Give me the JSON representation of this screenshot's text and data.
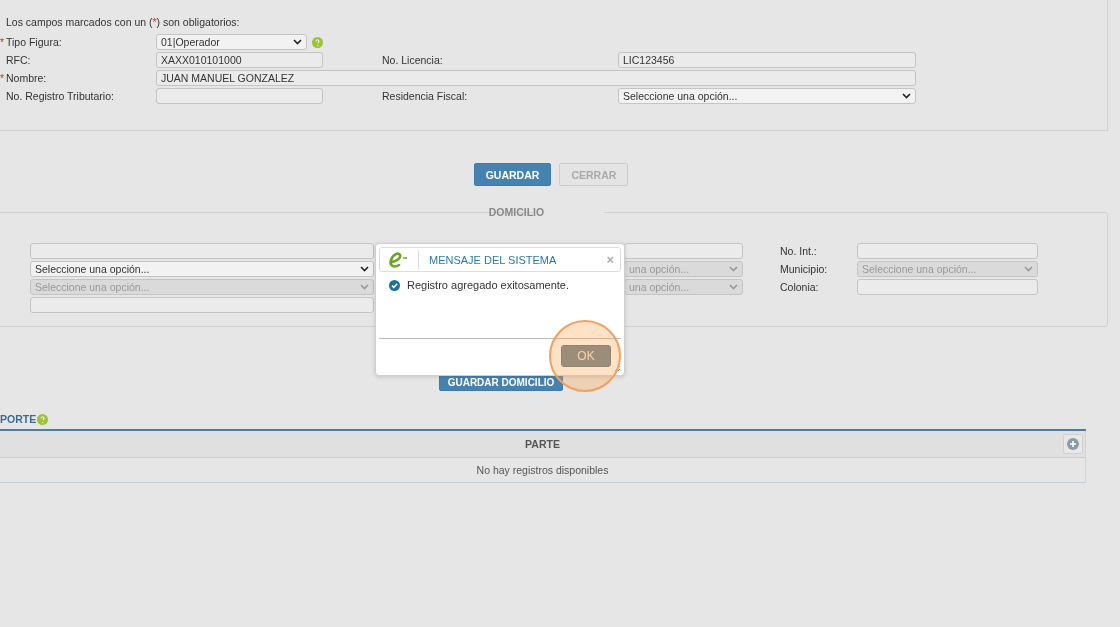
{
  "form": {
    "note": [
      "Los campos marcados con un (",
      "*",
      ") son obligatorios:"
    ],
    "rows": [
      {
        "fields": [
          {
            "label": "Tipo Figura:",
            "required": true,
            "kind": "select",
            "value": "01|Operador",
            "help": true
          }
        ]
      },
      {
        "fields": [
          {
            "label": "RFC:",
            "required": false,
            "kind": "input",
            "value": "XAXX010101000"
          },
          {
            "label": "No. Licencia:",
            "required": false,
            "kind": "input",
            "value": "LIC123456"
          }
        ]
      },
      {
        "fields": [
          {
            "label": "Nombre:",
            "required": true,
            "kind": "input",
            "value": "JUAN MANUEL GONZALEZ",
            "wide": true
          }
        ]
      },
      {
        "fields": [
          {
            "label": "No. Registro Tributario:",
            "required": false,
            "kind": "input"
          },
          {
            "label": "Residencia Fiscal:",
            "required": false,
            "kind": "select",
            "value": "Seleccione una opción..."
          }
        ]
      }
    ]
  },
  "buttons": [
    {
      "label": "GUARDAR",
      "disabled": false
    },
    {
      "label": "CERRAR",
      "disabled": true
    }
  ],
  "domicilio": {
    "legend": "DOMICILIO",
    "rows": [
      {
        "cells": [
          {
            "kind": "input",
            "disabled": false
          },
          {
            "kind": "input",
            "disabled": false
          },
          {
            "kind": "label",
            "text": "No. Int.:"
          },
          {
            "kind": "input",
            "disabled": false
          }
        ]
      },
      {
        "cells": [
          {
            "kind": "select",
            "disabled": false,
            "value": "Seleccione una opción..."
          },
          {
            "kind": "select",
            "disabled": true,
            "value": "una opción..."
          },
          {
            "kind": "label",
            "text": "Municipio:"
          },
          {
            "kind": "select",
            "disabled": true,
            "value": "Seleccione una opción..."
          }
        ]
      },
      {
        "cells": [
          {
            "kind": "select",
            "disabled": true,
            "value": "Seleccione una opción..."
          },
          {
            "kind": "select",
            "disabled": true,
            "value": "una opción..."
          },
          {
            "kind": "label",
            "text": "Colonia:"
          },
          {
            "kind": "input",
            "disabled": false
          }
        ]
      },
      {
        "cells": [
          {
            "kind": "input",
            "disabled": false
          }
        ]
      }
    ],
    "button": "GUARDAR DOMICILIO"
  },
  "section": {
    "title": "PORTE",
    "help": true
  },
  "table": {
    "columns": [
      "PARTE"
    ],
    "empty": "No hay registros disponibles"
  },
  "modal": {
    "title": "MENSAJE DEL SISTEMA",
    "close": "×",
    "message": "Registro agregado exitosamente.",
    "button": "OK",
    "highlighted": true
  }
}
